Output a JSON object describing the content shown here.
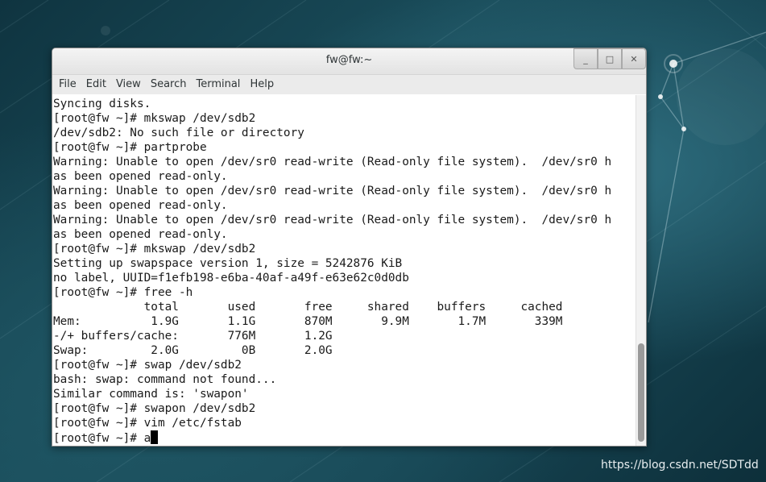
{
  "window": {
    "title": "fw@fw:~",
    "controls": {
      "minimize": "_",
      "maximize": "□",
      "close": "✕"
    }
  },
  "menubar": {
    "items": [
      "File",
      "Edit",
      "View",
      "Search",
      "Terminal",
      "Help"
    ]
  },
  "terminal": {
    "lines": [
      "Syncing disks.",
      "[root@fw ~]# mkswap /dev/sdb2",
      "/dev/sdb2: No such file or directory",
      "[root@fw ~]# partprobe",
      "Warning: Unable to open /dev/sr0 read-write (Read-only file system).  /dev/sr0 h",
      "as been opened read-only.",
      "Warning: Unable to open /dev/sr0 read-write (Read-only file system).  /dev/sr0 h",
      "as been opened read-only.",
      "Warning: Unable to open /dev/sr0 read-write (Read-only file system).  /dev/sr0 h",
      "as been opened read-only.",
      "[root@fw ~]# mkswap /dev/sdb2",
      "Setting up swapspace version 1, size = 5242876 KiB",
      "no label, UUID=f1efb198-e6ba-40af-a49f-e63e62c0d0db",
      "[root@fw ~]# free -h",
      "             total       used       free     shared    buffers     cached",
      "Mem:          1.9G       1.1G       870M       9.9M       1.7M       339M",
      "-/+ buffers/cache:       776M       1.2G",
      "Swap:         2.0G         0B       2.0G",
      "[root@fw ~]# swap /dev/sdb2",
      "bash: swap: command not found...",
      "Similar command is: 'swapon'",
      "[root@fw ~]# swapon /dev/sdb2",
      "[root@fw ~]# vim /etc/fstab"
    ],
    "prompt_line": "[root@fw ~]# a"
  },
  "watermark": "https://blog.csdn.net/SDTdd",
  "colors": {
    "desktop_bg": "#1a4d5b",
    "terminal_bg": "#ffffff",
    "terminal_fg": "#1a1a1a"
  }
}
